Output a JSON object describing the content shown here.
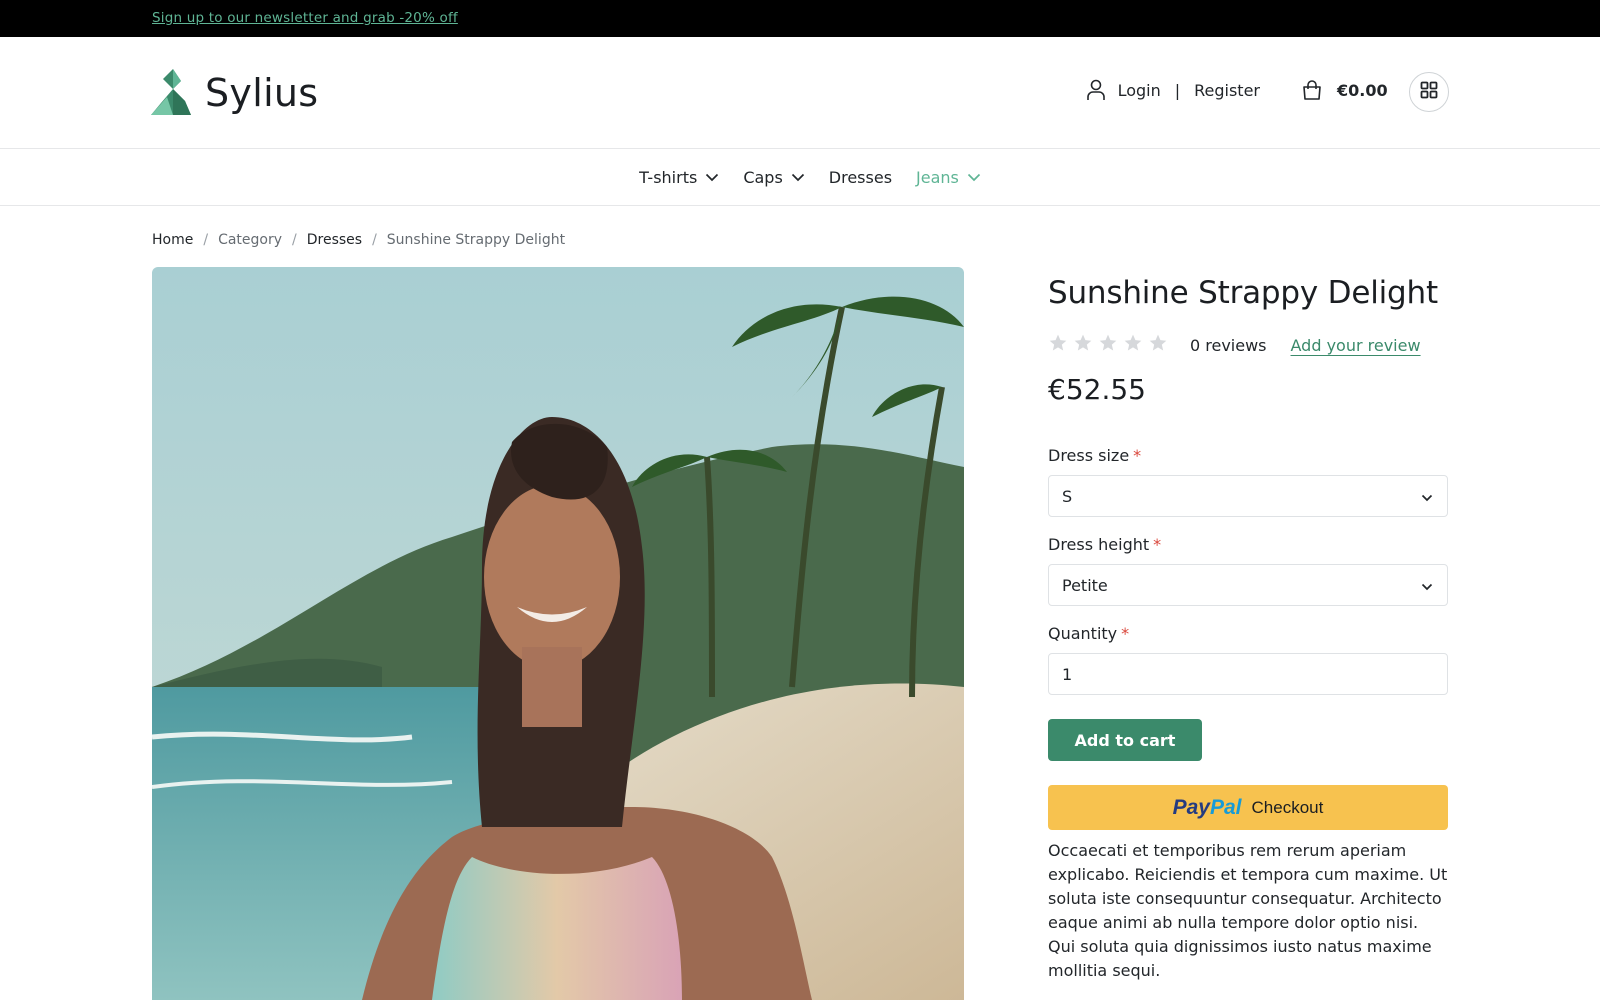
{
  "topbar": {
    "newsletter_link": "Sign up to our newsletter and grab -20% off"
  },
  "header": {
    "brand": "Sylius",
    "login_label": "Login",
    "separator": "|",
    "register_label": "Register",
    "cart_total": "€0.00"
  },
  "nav": {
    "items": [
      {
        "label": "T-shirts",
        "has_dropdown": true,
        "active": false
      },
      {
        "label": "Caps",
        "has_dropdown": true,
        "active": false
      },
      {
        "label": "Dresses",
        "has_dropdown": false,
        "active": false
      },
      {
        "label": "Jeans",
        "has_dropdown": true,
        "active": true
      }
    ]
  },
  "breadcrumb": {
    "home": "Home",
    "category": "Category",
    "dresses": "Dresses",
    "current": "Sunshine Strappy Delight",
    "separator": "/"
  },
  "product": {
    "title": "Sunshine Strappy Delight",
    "rating": 0,
    "rating_max": 5,
    "reviews_count": "0 reviews",
    "add_review": "Add your review",
    "price": "€52.55",
    "options": {
      "size_label": "Dress size",
      "size_value": "S",
      "height_label": "Dress height",
      "height_value": "Petite",
      "quantity_label": "Quantity",
      "quantity_value": "1",
      "required_mark": "*"
    },
    "add_to_cart": "Add to cart",
    "paypal": {
      "pay": "Pay",
      "pal": "Pal",
      "checkout": "Checkout"
    },
    "description": "Occaecati et temporibus rem rerum aperiam explicabo. Reiciendis et tempora cum maxime. Ut soluta iste consequuntur consequatur. Architecto eaque animi ab nulla tempore dolor optio nisi. Qui soluta quia dignissimos iusto natus maxime mollitia sequi."
  },
  "colors": {
    "accent": "#3b8a6b",
    "accent_light": "#5fb595",
    "paypal_yellow": "#f7c24f",
    "required": "#d9463b",
    "star_empty": "#d6d8db"
  },
  "icons": {
    "user": "user-icon",
    "bag": "shopping-bag-icon",
    "grid": "grid-icon",
    "chevron": "chevron-down-icon",
    "star": "star-icon",
    "logo": "swan-logo-icon"
  }
}
